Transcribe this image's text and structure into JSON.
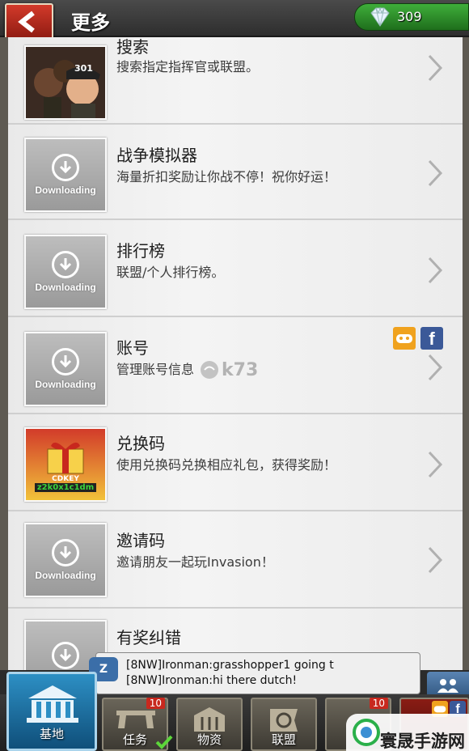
{
  "header": {
    "title": "更多",
    "gems": "309"
  },
  "list": [
    {
      "title": "搜索",
      "desc": "搜索指定指挥官或联盟。",
      "thumb": "commanders-image"
    },
    {
      "title": "战争模拟器",
      "desc": "海量折扣奖励让你战不停！祝你好运！",
      "thumb": "Downloading"
    },
    {
      "title": "排行榜",
      "desc": "联盟/个人排行榜。",
      "thumb": "Downloading"
    },
    {
      "title": "账号",
      "desc": "管理账号信息",
      "thumb": "Downloading"
    },
    {
      "title": "兑换码",
      "desc": "使用兑换码兑换相应礼包，获得奖励！",
      "thumb": "cdkey-gift-image"
    },
    {
      "title": "邀请码",
      "desc": "邀请朋友一起玩Invasion！",
      "thumb": "Downloading"
    },
    {
      "title": "有奖纠错",
      "desc": "",
      "thumb": "Downloading"
    }
  ],
  "thumb_texts": {
    "downloading": "Downloading",
    "cdkey": "CDKEY",
    "cdkey_code": "z2k0x1c1dm",
    "badge_301": "301"
  },
  "watermark_k73": "k73",
  "chat": {
    "badge": "Z",
    "lines": [
      "[8NW]Ironman:grasshopper1 going t",
      "[8NW]Ironman:hi there dutch!"
    ]
  },
  "nav": {
    "base": "基地",
    "tasks": "任务",
    "tasks_badge": "10",
    "resources": "物资",
    "alliance": "联盟",
    "extra_badge": "10"
  },
  "watermark": "寰晟手游网",
  "colors": {
    "accent_red": "#c8281e",
    "gem_green": "#2e8f2a",
    "base_blue": "#2d8fc4"
  }
}
